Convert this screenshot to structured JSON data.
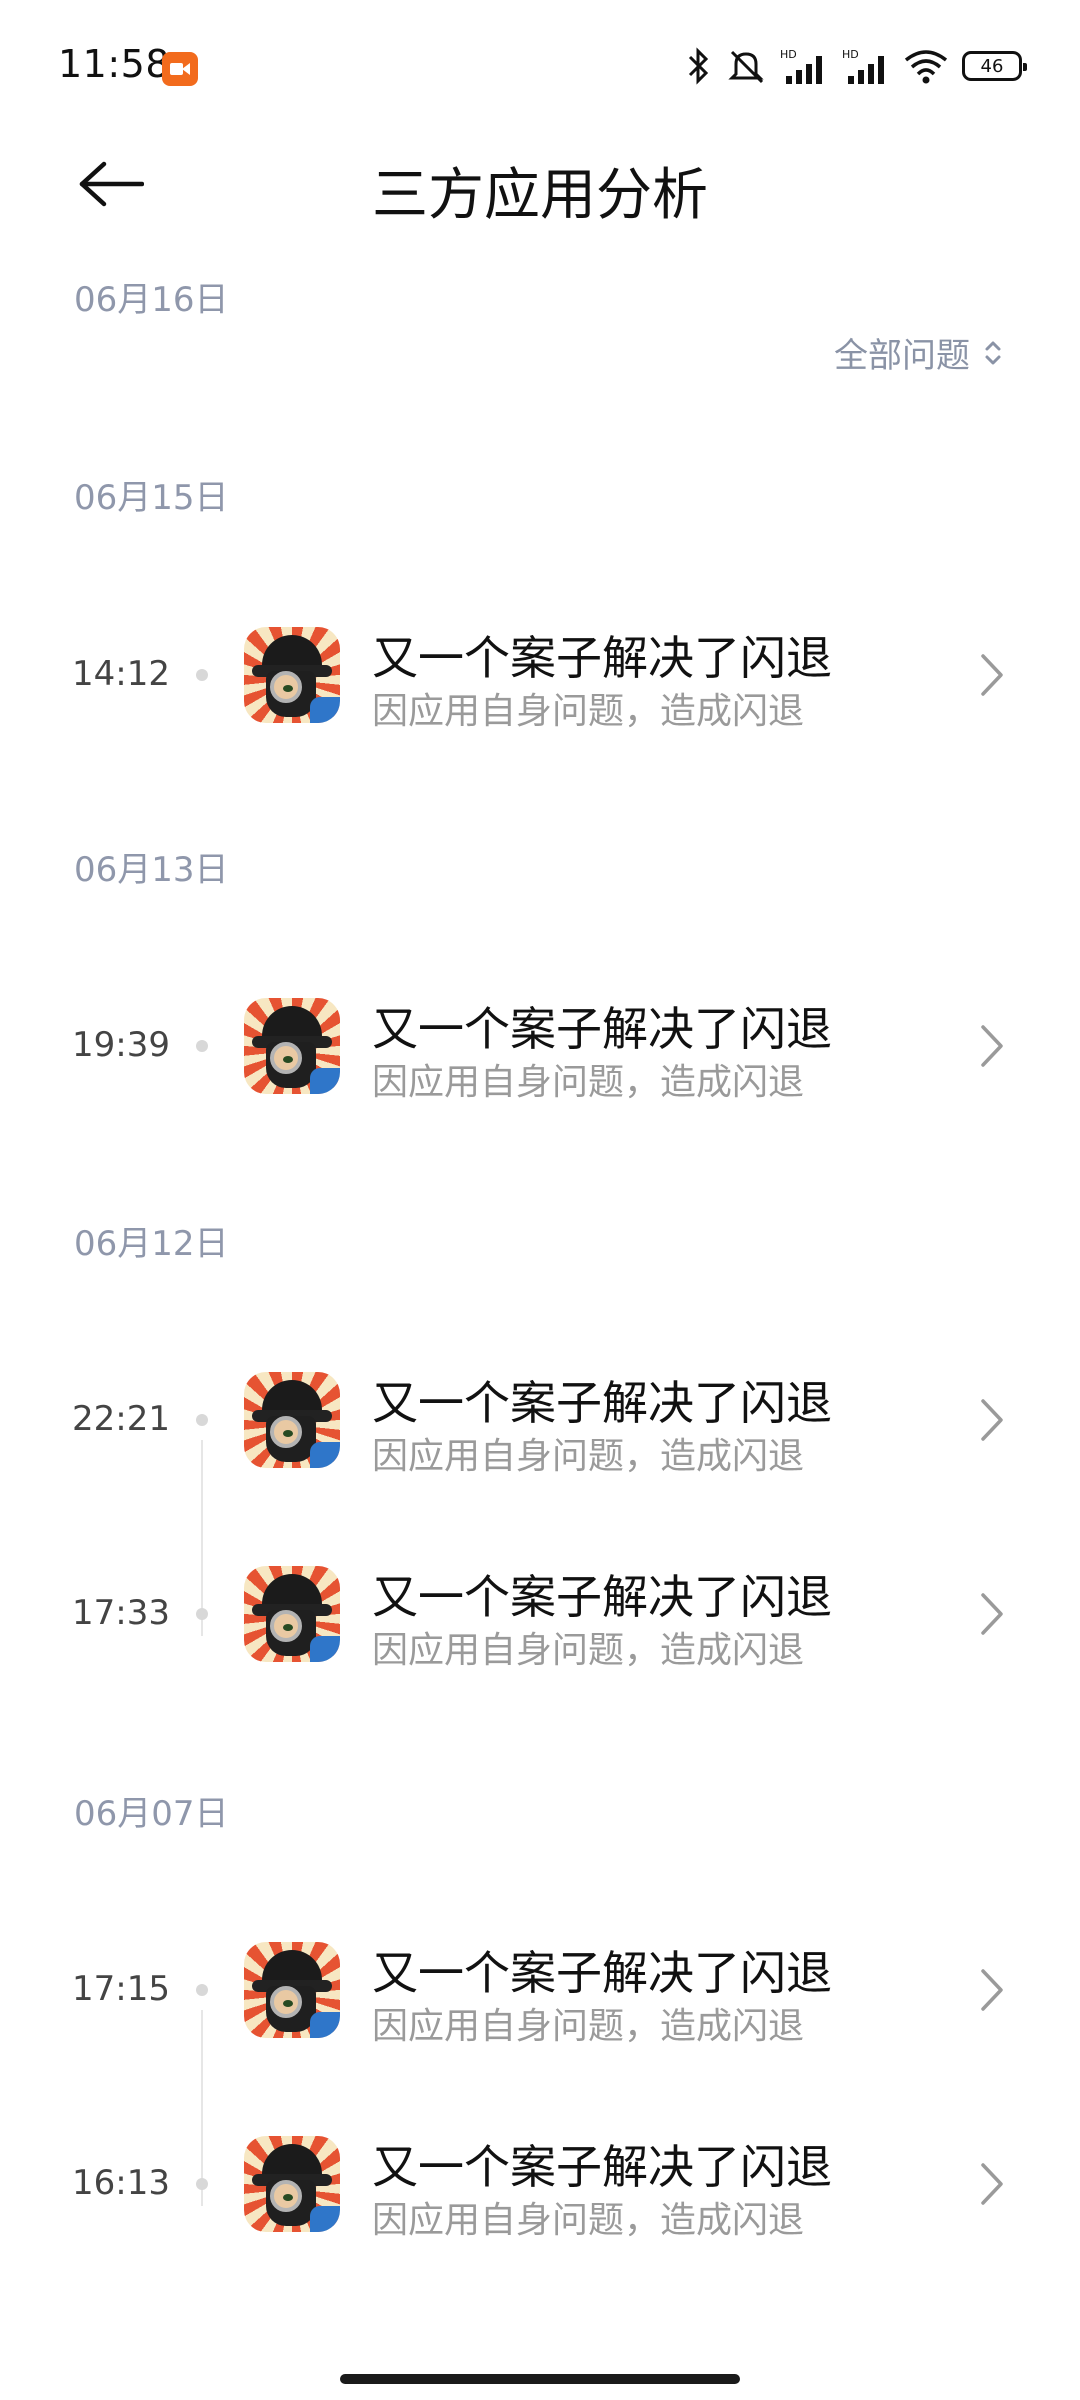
{
  "status_bar": {
    "time": "11:58",
    "battery": "46",
    "icons": [
      "record-icon",
      "bluetooth-icon",
      "mute-icon",
      "hd-signal-icon",
      "hd-signal-icon",
      "wifi-icon",
      "battery-icon"
    ]
  },
  "header": {
    "title": "三方应用分析",
    "back_icon": "back-arrow-icon"
  },
  "filter": {
    "label": "全部问题",
    "icon": "sort-updown-icon"
  },
  "groups": [
    {
      "date": "06月16日",
      "items": []
    },
    {
      "date": "06月15日",
      "items": [
        {
          "time": "14:12",
          "title": "又一个案子解决了闪退",
          "subtitle": "因应用自身问题，造成闪退"
        }
      ]
    },
    {
      "date": "06月13日",
      "items": [
        {
          "time": "19:39",
          "title": "又一个案子解决了闪退",
          "subtitle": "因应用自身问题，造成闪退"
        }
      ]
    },
    {
      "date": "06月12日",
      "items": [
        {
          "time": "22:21",
          "title": "又一个案子解决了闪退",
          "subtitle": "因应用自身问题，造成闪退"
        },
        {
          "time": "17:33",
          "title": "又一个案子解决了闪退",
          "subtitle": "因应用自身问题，造成闪退"
        }
      ]
    },
    {
      "date": "06月07日",
      "items": [
        {
          "time": "17:15",
          "title": "又一个案子解决了闪退",
          "subtitle": "因应用自身问题，造成闪退"
        },
        {
          "time": "16:13",
          "title": "又一个案子解决了闪退",
          "subtitle": "因应用自身问题，造成闪退"
        }
      ]
    }
  ],
  "colors": {
    "date": "#8f97ab",
    "subtitle": "#9a9a9a",
    "accent_icon_red": "#e65332",
    "status_record": "#f26b1d"
  }
}
